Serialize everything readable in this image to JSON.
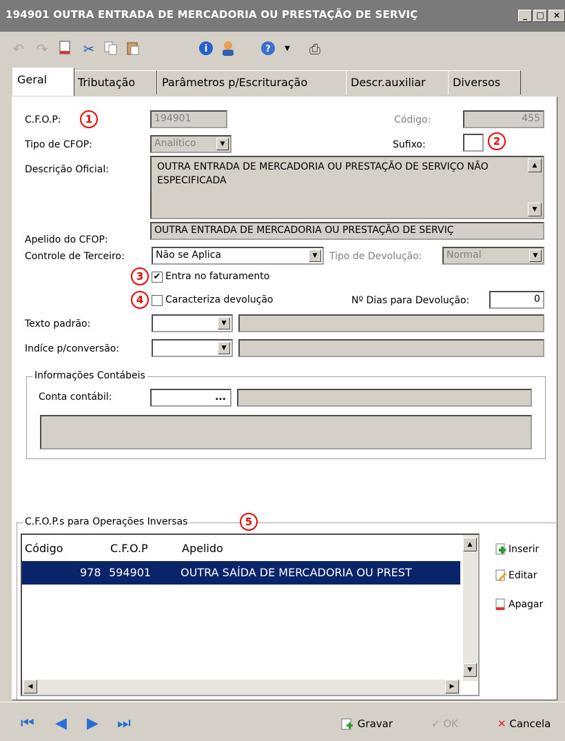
{
  "window": {
    "title": "194901 OUTRA ENTRADA DE MERCADORIA OU PRESTAÇÃO DE SERVIÇ",
    "buttons": [
      "_",
      "□",
      "×"
    ]
  },
  "toolbar": {
    "icons": [
      "undo-icon",
      "redo-icon",
      "new-icon",
      "cut-icon",
      "copy-icon",
      "paste-icon",
      "info-icon",
      "user-icon",
      "help-icon",
      "dropdown-icon",
      "export-icon"
    ]
  },
  "tabs": [
    "Geral",
    "Tributação",
    "Parâmetros p/Escrituração",
    "Descr.auxiliar",
    "Diversos"
  ],
  "form": {
    "cfop_label": "C.F.O.P:",
    "cfop_value": "194901",
    "codigo_label": "Código:",
    "codigo_value": "455",
    "tipo_label": "Tipo de CFOP:",
    "tipo_value": "Analítico",
    "sufixo_label": "Sufixo:",
    "sufixo_value": "",
    "descricao_label": "Descrição Oficial:",
    "descricao_value": "OUTRA ENTRADA DE MERCADORIA OU PRESTAÇÃO DE SERVIÇO NÃO ESPECIFICADA",
    "apelido_label": "Apelido do CFOP:",
    "apelido_value": "OUTRA ENTRADA DE MERCADORIA OU PRESTAÇÃO DE SERVIÇ",
    "controle_label": "Controle de Terceiro:",
    "controle_value": "Não se Aplica",
    "tipo_dev_label": "Tipo de Devolução:",
    "tipo_dev_value": "Normal",
    "entra_label": "Entra no faturamento",
    "entra_checked": "✔",
    "caracteriza_label": "Caracteriza devolução",
    "dias_label": "Nº Dias para Devolução:",
    "dias_value": "0",
    "texto_label": "Texto padrão:",
    "texto_value": "",
    "indice_label": "Indíce p/conversão:",
    "indice_value": ""
  },
  "contabeis": {
    "title": "Informações Contábeis",
    "conta_label": "Conta contábil:",
    "conta_value": "",
    "ellipsis": "..."
  },
  "inversas": {
    "title": "C.F.O.P.s para Operações Inversas",
    "columns": [
      "Código",
      "C.F.O.P",
      "Apelido"
    ],
    "rows": [
      {
        "codigo": "978",
        "cfop": "594901",
        "apelido": "OUTRA SAÍDA DE MERCADORIA OU PREST"
      }
    ],
    "buttons": {
      "inserir": "Inserir",
      "editar": "Editar",
      "apagar": "Apagar"
    }
  },
  "badges": [
    "1",
    "2",
    "3",
    "4",
    "5"
  ],
  "footer": {
    "gravar": "Gravar",
    "ok": "OK",
    "cancelar": "Cancela"
  },
  "colors": {
    "selection": "#0a246a",
    "badge": "#e00000",
    "nav": "#2a6fcf"
  }
}
